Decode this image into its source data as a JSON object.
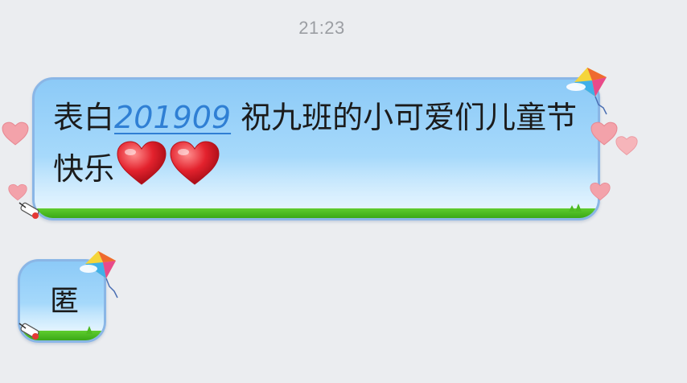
{
  "timestamp": "21:23",
  "messages": [
    {
      "text_before": "表白",
      "link": "201909",
      "text_after": " 祝九班的小可爱们儿童节快乐",
      "emoji": [
        "red-heart",
        "red-heart"
      ]
    },
    {
      "text": "匿"
    }
  ],
  "colors": {
    "background": "#ebedf0",
    "bubble_sky": "#a6d9fb",
    "bubble_border": "#8ab6e6",
    "grass": "#4dba22",
    "link": "#2f7fd4",
    "heart": "#f08a94",
    "timestamp": "#9b9ea3"
  },
  "icons": {
    "kite": "kite-icon",
    "heart": "heart-icon",
    "pin": "pencil-pin-icon"
  }
}
